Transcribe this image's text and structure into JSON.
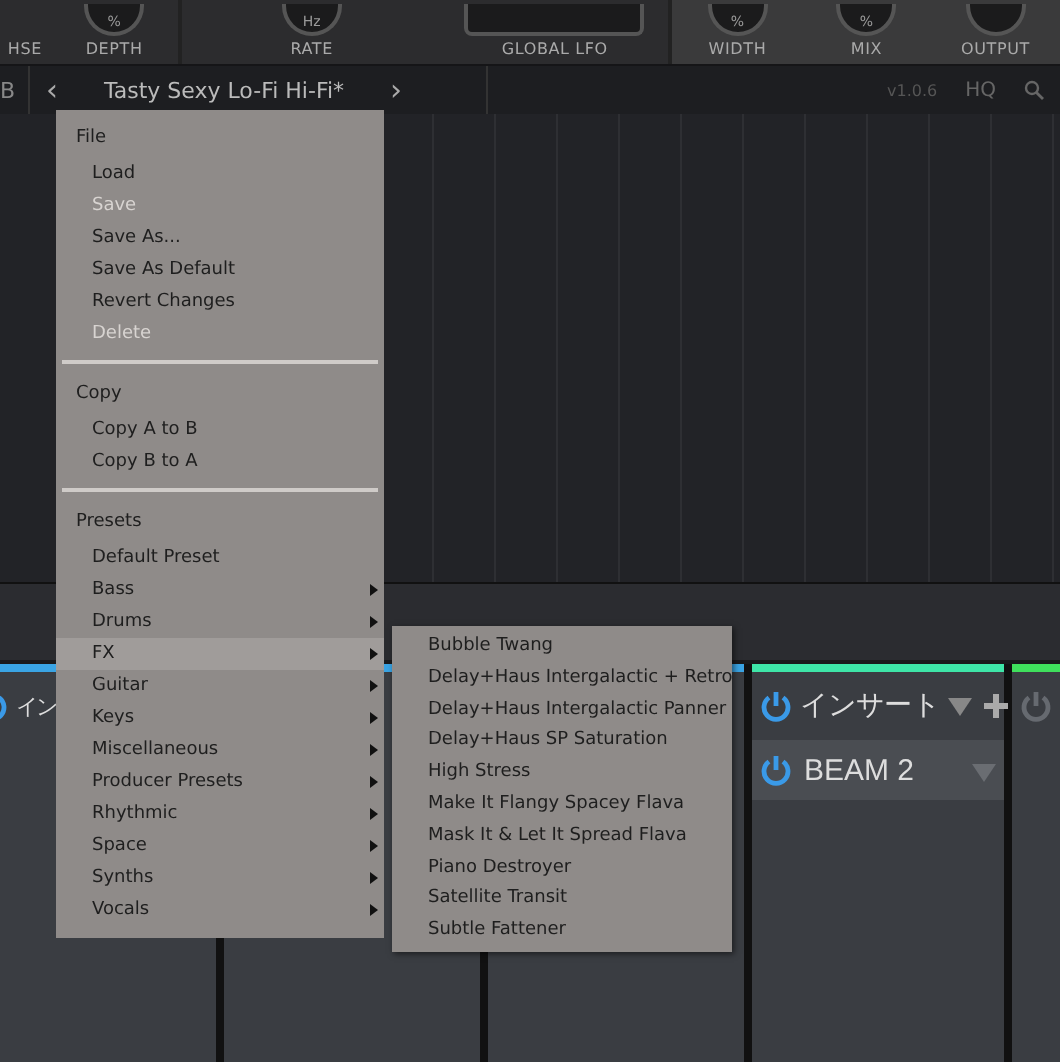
{
  "plugin_panel": {
    "controls": [
      {
        "label": "HSE"
      },
      {
        "label": "DEPTH",
        "unit": "%"
      },
      {
        "label": "RATE",
        "unit": "Hz"
      },
      {
        "label": "GLOBAL LFO"
      },
      {
        "label": "WIDTH",
        "unit": "%"
      },
      {
        "label": "MIX",
        "unit": "%"
      },
      {
        "label": "OUTPUT"
      }
    ]
  },
  "preset_bar": {
    "ab": "B",
    "prev": "‹",
    "title": "Tasty Sexy Lo-Fi Hi-Fi*",
    "next": "›",
    "version": "v1.0.6",
    "quality": "HQ"
  },
  "channels": [
    {
      "color": "#3aa4e4",
      "on": true,
      "header": "イン",
      "header_buttons": false
    },
    {
      "color": "#3aa4e4"
    },
    {
      "color": "#3aa4e4"
    },
    {
      "color": "#3ee6a8",
      "on": true,
      "header": "インサート",
      "header_buttons": true,
      "inserts": [
        {
          "name": "BEAM 2",
          "on": true
        }
      ]
    },
    {
      "color": "#3fe05c",
      "on": false
    }
  ],
  "menu": {
    "items": [
      {
        "kind": "header",
        "label": "File"
      },
      {
        "kind": "item",
        "label": "Load",
        "disabled": false
      },
      {
        "kind": "item",
        "label": "Save",
        "disabled": true
      },
      {
        "kind": "item",
        "label": "Save As...",
        "disabled": false
      },
      {
        "kind": "item",
        "label": "Save As Default",
        "disabled": false
      },
      {
        "kind": "item",
        "label": "Revert Changes",
        "disabled": false
      },
      {
        "kind": "item",
        "label": "Delete",
        "disabled": true
      },
      {
        "kind": "separator"
      },
      {
        "kind": "header",
        "label": "Copy"
      },
      {
        "kind": "item",
        "label": "Copy A to B",
        "disabled": false
      },
      {
        "kind": "item",
        "label": "Copy B to A",
        "disabled": false
      },
      {
        "kind": "separator"
      },
      {
        "kind": "header",
        "label": "Presets"
      },
      {
        "kind": "item",
        "label": "Default Preset",
        "disabled": false
      },
      {
        "kind": "submenu",
        "label": "Bass",
        "selected": false
      },
      {
        "kind": "submenu",
        "label": "Drums",
        "selected": false
      },
      {
        "kind": "submenu",
        "label": "FX",
        "selected": true
      },
      {
        "kind": "submenu",
        "label": "Guitar",
        "selected": false
      },
      {
        "kind": "submenu",
        "label": "Keys",
        "selected": false
      },
      {
        "kind": "submenu",
        "label": "Miscellaneous",
        "selected": false
      },
      {
        "kind": "submenu",
        "label": "Producer Presets",
        "selected": false
      },
      {
        "kind": "submenu",
        "label": "Rhythmic",
        "selected": false
      },
      {
        "kind": "submenu",
        "label": "Space",
        "selected": false
      },
      {
        "kind": "submenu",
        "label": "Synths",
        "selected": false
      },
      {
        "kind": "submenu",
        "label": "Vocals",
        "selected": false
      }
    ]
  },
  "submenu": {
    "items": [
      "Bubble Twang",
      "Delay+Haus Intergalactic + Retro",
      "Delay+Haus Intergalactic Panner",
      "Delay+Haus SP Saturation",
      "High Stress",
      "Make It Flangy Spacey Flava",
      "Mask It & Let It Spread Flava",
      "Piano Destroyer",
      "Satellite Transit",
      "Subtle Fattener"
    ]
  }
}
